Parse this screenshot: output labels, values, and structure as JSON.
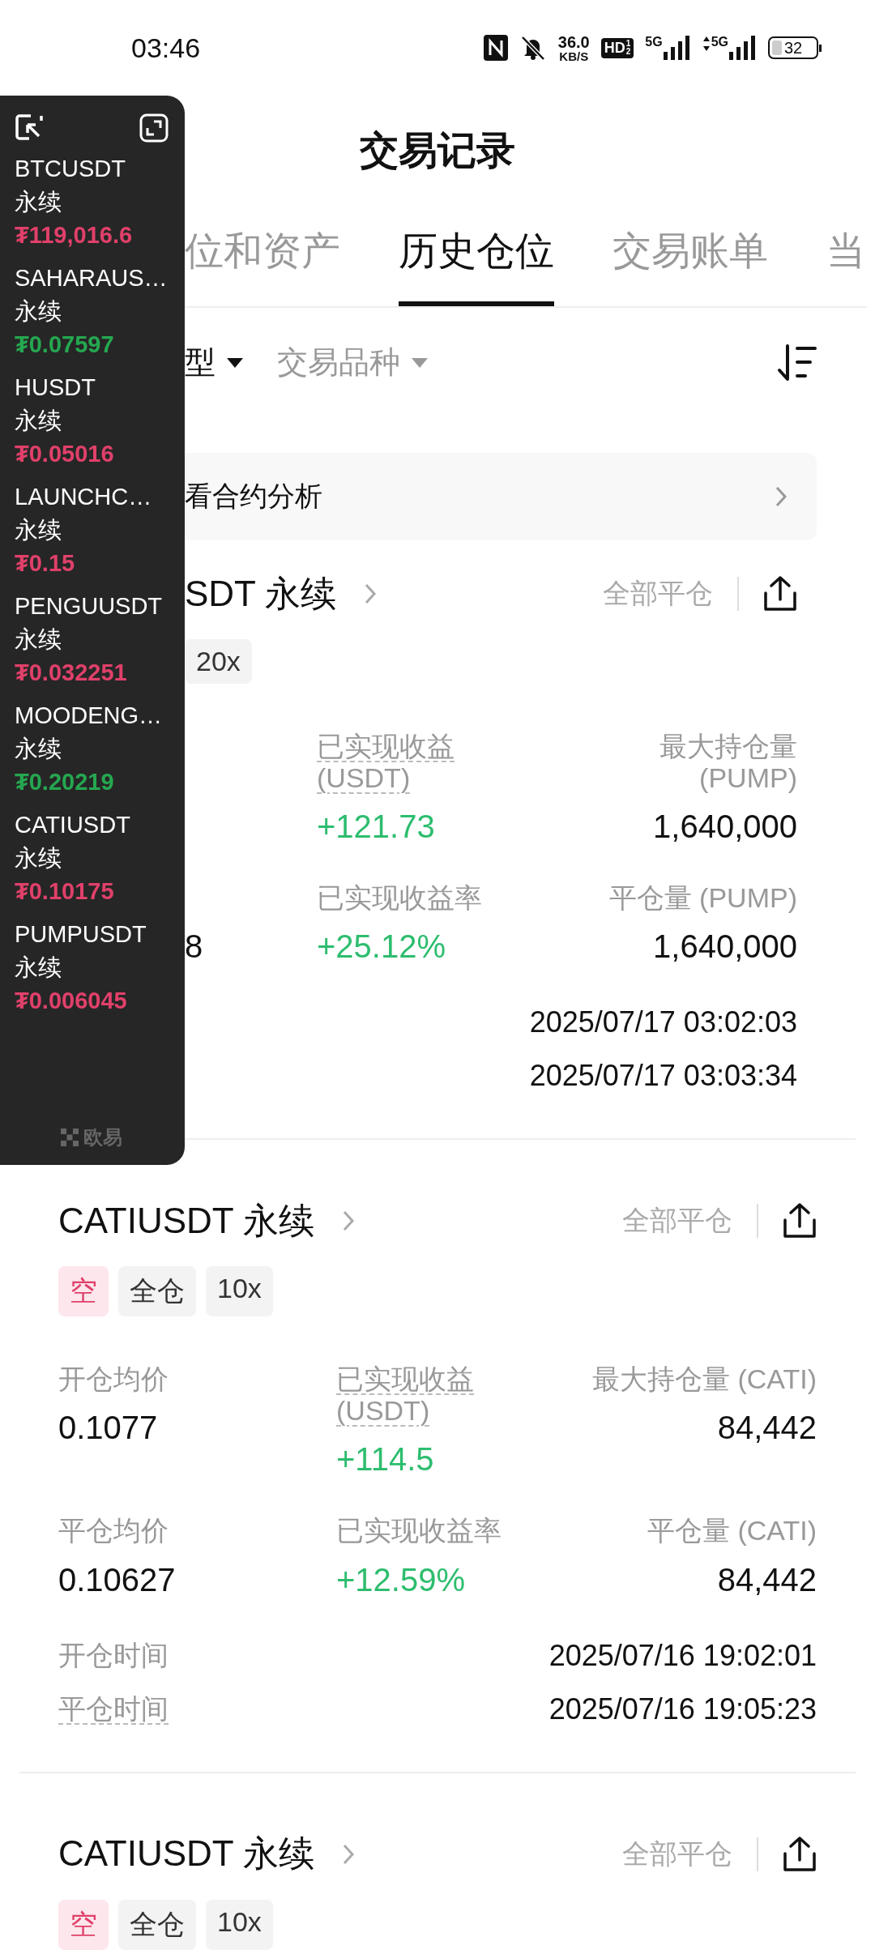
{
  "status": {
    "time": "03:46",
    "speed_value": "36.0",
    "speed_unit": "KB/S",
    "hd": "HD",
    "hd_slots": [
      "1",
      "2"
    ],
    "networks": [
      "5G",
      "5G"
    ],
    "battery": "32"
  },
  "panel": {
    "items": [
      {
        "symbol": "BTCUSDT",
        "type": "永续",
        "price": "₮119,016.6",
        "color": "#e0406a"
      },
      {
        "symbol": "SAHARAUS…",
        "type": "永续",
        "price": "₮0.07597",
        "color": "#25a750"
      },
      {
        "symbol": "HUSDT",
        "type": "永续",
        "price": "₮0.05016",
        "color": "#e0406a"
      },
      {
        "symbol": "LAUNCHC…",
        "type": "永续",
        "price": "₮0.15",
        "color": "#e0406a"
      },
      {
        "symbol": "PENGUUSDT",
        "type": "永续",
        "price": "₮0.032251",
        "color": "#e0406a"
      },
      {
        "symbol": "MOODENG…",
        "type": "永续",
        "price": "₮0.20219",
        "color": "#25a750"
      },
      {
        "symbol": "CATIUSDT",
        "type": "永续",
        "price": "₮0.10175",
        "color": "#e0406a"
      },
      {
        "symbol": "PUMPUSDT",
        "type": "永续",
        "price": "₮0.006045",
        "color": "#e0406a"
      }
    ],
    "brand": "欧易"
  },
  "title": "交易记录",
  "tabs": [
    {
      "label": "位和资产",
      "selected": false
    },
    {
      "label": "历史仓位",
      "selected": true
    },
    {
      "label": "交易账单",
      "selected": false
    },
    {
      "label": "当",
      "selected": false
    }
  ],
  "filters": [
    {
      "label": "型",
      "active": true
    },
    {
      "label": "交易品种",
      "active": false
    }
  ],
  "banner": "看合约分析",
  "cards": [
    {
      "title": "SDT 永续",
      "close_all": "全部平仓",
      "tags": [
        {
          "text": "20x",
          "kind": "leverage"
        }
      ],
      "stats": [
        {
          "middle": {
            "label": "已实现收益 (USDT)",
            "dashed": true,
            "value": "+121.73",
            "gain": true
          },
          "right": {
            "label": "最大持仓量 (PUMP)",
            "dashed": false,
            "value": "1,640,000",
            "gain": false
          }
        },
        {
          "left": {
            "value": "8",
            "gain": false
          },
          "middle": {
            "label": "已实现收益率",
            "dashed": false,
            "value": "+25.12%",
            "gain": true
          },
          "right": {
            "label": "平仓量 (PUMP)",
            "dashed": false,
            "value": "1,640,000",
            "gain": false
          }
        }
      ],
      "times": [
        {
          "value": "2025/07/17 03:02:03"
        },
        {
          "value": "2025/07/17 03:03:34"
        }
      ]
    },
    {
      "title": "CATIUSDT 永续",
      "close_all": "全部平仓",
      "tags": [
        {
          "text": "空",
          "kind": "side"
        },
        {
          "text": "全仓",
          "kind": "mode"
        },
        {
          "text": "10x",
          "kind": "leverage"
        }
      ],
      "stats": [
        {
          "left": {
            "label": "开仓均价",
            "dashed": false,
            "value": "0.1077",
            "gain": false
          },
          "middle": {
            "label": "已实现收益 (USDT)",
            "dashed": true,
            "value": "+114.5",
            "gain": true
          },
          "right": {
            "label": "最大持仓量 (CATI)",
            "dashed": false,
            "value": "84,442",
            "gain": false
          }
        },
        {
          "left": {
            "label": "平仓均价",
            "dashed": false,
            "value": "0.10627",
            "gain": false
          },
          "middle": {
            "label": "已实现收益率",
            "dashed": false,
            "value": "+12.59%",
            "gain": true
          },
          "right": {
            "label": "平仓量 (CATI)",
            "dashed": false,
            "value": "84,442",
            "gain": false
          }
        }
      ],
      "times": [
        {
          "label": "开仓时间",
          "dashed": false,
          "value": "2025/07/16 19:02:01"
        },
        {
          "label": "平仓时间",
          "dashed": true,
          "value": "2025/07/16 19:05:23"
        }
      ]
    },
    {
      "title": "CATIUSDT 永续",
      "close_all": "全部平仓",
      "tags": [
        {
          "text": "空",
          "kind": "side"
        },
        {
          "text": "全仓",
          "kind": "mode"
        },
        {
          "text": "10x",
          "kind": "leverage"
        }
      ]
    }
  ]
}
